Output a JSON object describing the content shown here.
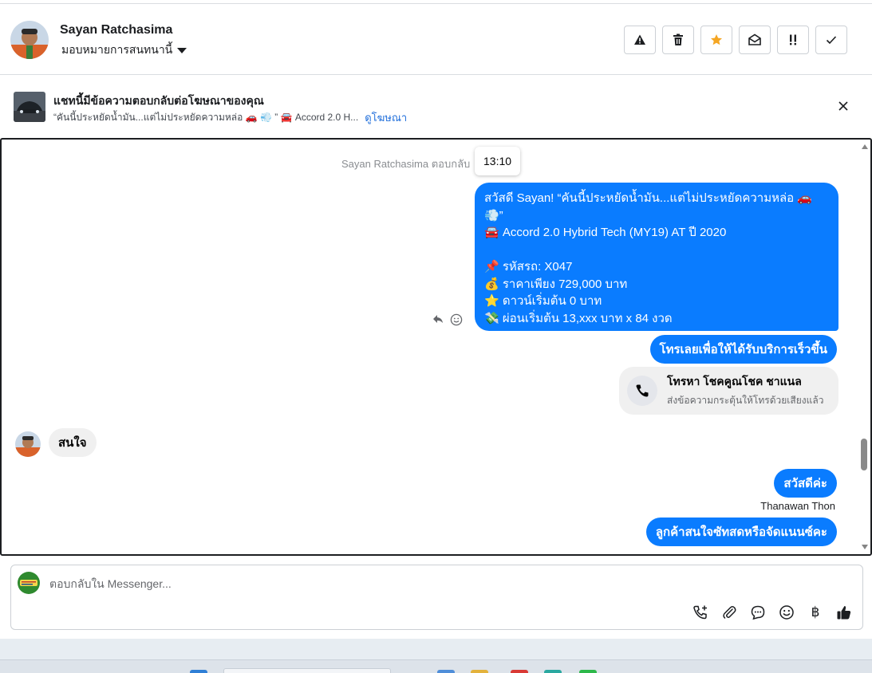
{
  "header": {
    "contact_name": "Sayan Ratchasima",
    "assign_label": "มอบหมายการสนทนานี้",
    "actions": [
      {
        "name": "spam-icon",
        "glyph": "!"
      },
      {
        "name": "trash-icon"
      },
      {
        "name": "star-icon",
        "color": "#f5a623"
      },
      {
        "name": "open-envelope-icon"
      },
      {
        "name": "follow-up-icon",
        "glyph": "!!"
      },
      {
        "name": "check-icon"
      }
    ]
  },
  "ad_reply": {
    "title": "แชทนี้มีข้อความตอบกลับต่อโฆษณาของคุณ",
    "snippet": "“คันนี้ประหยัดน้ำมัน...แต่ไม่ประหยัดความหล่อ 🚗 💨 ” 🚘 Accord 2.0 H...",
    "link_label": "ดูโฆษณา"
  },
  "thread": {
    "system_note": "Sayan Ratchasima ตอบกลับ",
    "tooltip_time": "13:10",
    "ad_message": "สวัสดี Sayan! “คันนี้ประหยัดน้ำมัน...แต่ไม่ประหยัดความหล่อ 🚗💨”\n🚘 Accord 2.0 Hybrid Tech (MY19) AT ปี 2020\n\n📌 รหัสรถ: X047\n💰 ราคาเพียง 729,000 บาท\n⭐ ดาวน์เริ่มต้น 0 บาท\n💸 ผ่อนเริ่มต้น 13,xxx บาท x 84 งวด\n.",
    "call_button_msg": "โทรเลยเพื่อให้ได้รับบริการเร็วขึ้น",
    "call_card_title": "โทรหา โชคคูณโชค ชาแนล",
    "call_card_sub": "ส่งข้อความกระตุ้นให้โทรด้วยเสียงแล้ว",
    "customer_reply": "สนใจ",
    "agent_greeting": "สวัสดีค่ะ",
    "agent_name": "Thanawan Thon",
    "agent_question": "ลูกค้าสนใจซัทสดหรือจัดแนนซ์คะ"
  },
  "composer": {
    "placeholder": "ตอบกลับใน Messenger...",
    "tools": [
      "add-call-icon",
      "attachment-icon",
      "saved-reply-icon",
      "emoji-icon",
      "baht-payment-icon",
      "like-icon"
    ],
    "baht_glyph": "฿"
  },
  "colors": {
    "accent": "#0a7cff",
    "star": "#f5a623",
    "link": "#216fdb"
  }
}
